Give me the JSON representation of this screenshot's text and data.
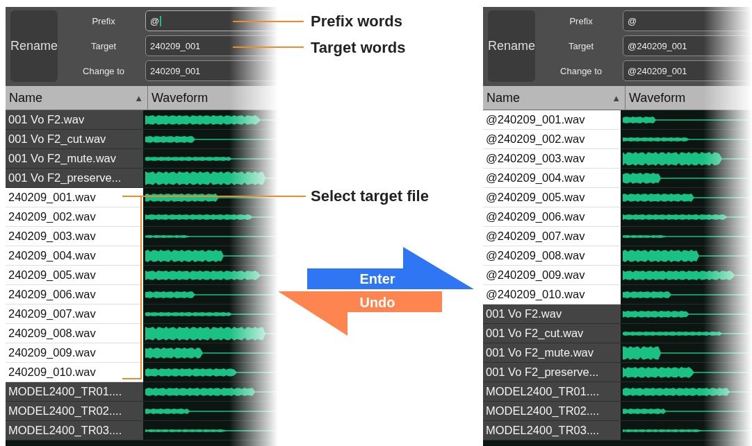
{
  "panels": [
    {
      "rename_button": "Rename",
      "fields": [
        {
          "label": "Prefix",
          "value": "@",
          "focused": true
        },
        {
          "label": "Target",
          "value": "240209_001",
          "focused": false
        },
        {
          "label": "Change to",
          "value": "240209_001",
          "focused": false
        }
      ],
      "columns": [
        {
          "label": "Name",
          "sort_indicator": "▲"
        },
        {
          "label": "Waveform"
        }
      ],
      "rows": [
        {
          "name": "001 Vo F2.wav",
          "selected": false
        },
        {
          "name": "001 Vo F2_cut.wav",
          "selected": false
        },
        {
          "name": "001 Vo F2_mute.wav",
          "selected": false
        },
        {
          "name": "001 Vo F2_preserve...",
          "selected": false
        },
        {
          "name": "240209_001.wav",
          "selected": true
        },
        {
          "name": "240209_002.wav",
          "selected": true
        },
        {
          "name": "240209_003.wav",
          "selected": true
        },
        {
          "name": "240209_004.wav",
          "selected": true
        },
        {
          "name": "240209_005.wav",
          "selected": true
        },
        {
          "name": "240209_006.wav",
          "selected": true
        },
        {
          "name": "240209_007.wav",
          "selected": true
        },
        {
          "name": "240209_008.wav",
          "selected": true
        },
        {
          "name": "240209_009.wav",
          "selected": true
        },
        {
          "name": "240209_010.wav",
          "selected": true
        },
        {
          "name": "MODEL2400_TR01....",
          "selected": false
        },
        {
          "name": "MODEL2400_TR02....",
          "selected": false
        },
        {
          "name": "MODEL2400_TR03....",
          "selected": false
        }
      ]
    },
    {
      "rename_button": "Rename",
      "fields": [
        {
          "label": "Prefix",
          "value": "@",
          "focused": false
        },
        {
          "label": "Target",
          "value": "@240209_001",
          "focused": false
        },
        {
          "label": "Change to",
          "value": "@240209_001",
          "focused": false
        }
      ],
      "columns": [
        {
          "label": "Name",
          "sort_indicator": "▲"
        },
        {
          "label": "Waveform"
        }
      ],
      "rows": [
        {
          "name": "@240209_001.wav",
          "selected": true
        },
        {
          "name": "@240209_002.wav",
          "selected": true
        },
        {
          "name": "@240209_003.wav",
          "selected": true
        },
        {
          "name": "@240209_004.wav",
          "selected": true
        },
        {
          "name": "@240209_005.wav",
          "selected": true
        },
        {
          "name": "@240209_006.wav",
          "selected": true
        },
        {
          "name": "@240209_007.wav",
          "selected": true
        },
        {
          "name": "@240209_008.wav",
          "selected": true
        },
        {
          "name": "@240209_009.wav",
          "selected": true
        },
        {
          "name": "@240209_010.wav",
          "selected": true
        },
        {
          "name": "001 Vo F2.wav",
          "selected": false
        },
        {
          "name": "001 Vo F2_cut.wav",
          "selected": false
        },
        {
          "name": "001 Vo F2_mute.wav",
          "selected": false
        },
        {
          "name": "001 Vo F2_preserve...",
          "selected": false
        },
        {
          "name": "MODEL2400_TR01....",
          "selected": false
        },
        {
          "name": "MODEL2400_TR02....",
          "selected": false
        },
        {
          "name": "MODEL2400_TR03....",
          "selected": false
        }
      ]
    }
  ],
  "callouts": [
    {
      "text": "Prefix words"
    },
    {
      "text": "Target words"
    },
    {
      "text": "Select target file"
    }
  ],
  "arrows": [
    {
      "label": "Enter",
      "kind": "forward",
      "color": "#2f76f5"
    },
    {
      "label": "Undo",
      "kind": "back",
      "color": "#ff8550"
    }
  ]
}
